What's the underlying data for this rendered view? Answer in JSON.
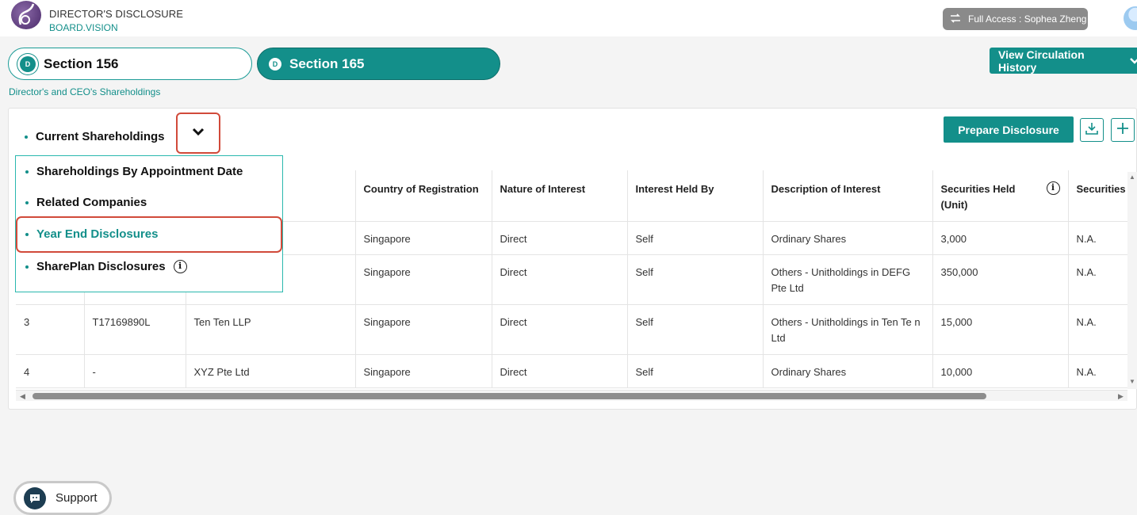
{
  "header": {
    "title": "DIRECTOR'S DISCLOSURE",
    "subtitle": "BOARD.VISION",
    "access_label": "Full Access : Sophea Zheng"
  },
  "tabs": [
    {
      "label": "Section 156",
      "badge": "D",
      "active": false
    },
    {
      "label": "Section 165",
      "badge": "D",
      "active": true
    }
  ],
  "breadcrumb": "Director's and CEO's Shareholdings",
  "circulation_button": "View Circulation History",
  "current_view": "Current Shareholdings",
  "prepare_button": "Prepare Disclosure",
  "dropdown": {
    "items": [
      {
        "label": "Shareholdings By Appointment Date",
        "active": false
      },
      {
        "label": "Related Companies",
        "active": false
      },
      {
        "label": "Year End Disclosures",
        "active": true
      },
      {
        "label": "SharePlan Disclosures",
        "active": false,
        "info": "i"
      }
    ]
  },
  "table": {
    "columns": [
      "Country of Registration",
      "Nature of Interest",
      "Interest Held By",
      "Description of Interest",
      "Securities Held (Unit)",
      "Securities"
    ],
    "securities_info": "i",
    "rows": [
      {
        "no": "",
        "reg": "",
        "name": "",
        "country": "Singapore",
        "nature": "Direct",
        "held_by": "Self",
        "description": "Ordinary Shares",
        "units": "3,000",
        "securities": "N.A."
      },
      {
        "no": "",
        "reg": "",
        "name": "",
        "country": "Singapore",
        "nature": "Direct",
        "held_by": "Self",
        "description": "Others - Unitholdings in DEFG Pte Ltd",
        "units": "350,000",
        "securities": "N.A."
      },
      {
        "no": "3",
        "reg": "T17169890L",
        "name": "Ten Ten LLP",
        "country": "Singapore",
        "nature": "Direct",
        "held_by": "Self",
        "description": "Others - Unitholdings in Ten Te n Ltd",
        "units": "15,000",
        "securities": "N.A."
      },
      {
        "no": "4",
        "reg": "-",
        "name": "XYZ Pte Ltd",
        "country": "Singapore",
        "nature": "Direct",
        "held_by": "Self",
        "description": "Ordinary Shares",
        "units": "10,000",
        "securities": "N.A."
      }
    ]
  },
  "support_label": "Support",
  "colors": {
    "accent": "#138f8a",
    "highlight": "#d14a3a"
  }
}
